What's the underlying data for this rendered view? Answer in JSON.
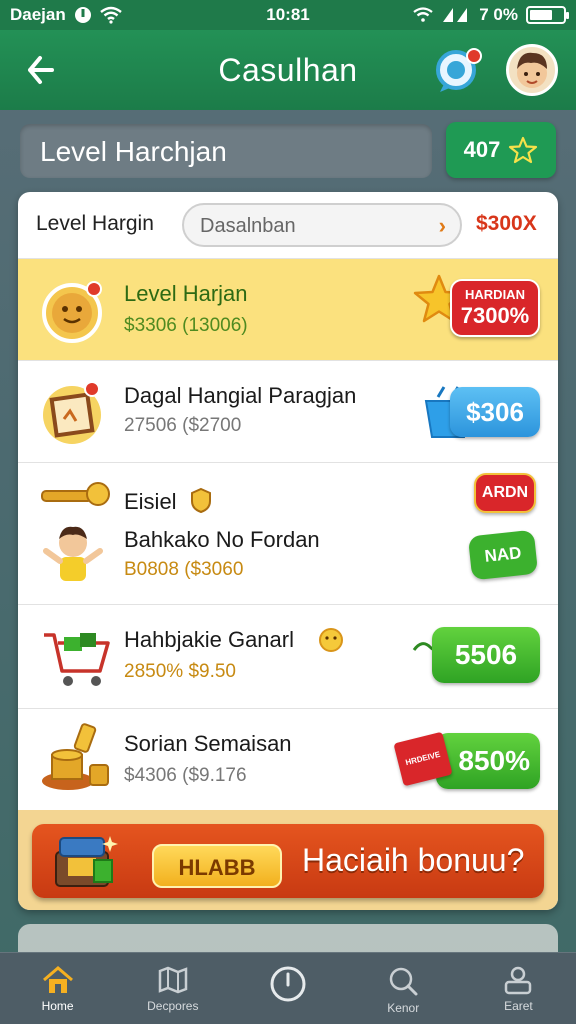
{
  "status_bar": {
    "carrier": "Daejan",
    "time": "10:81",
    "battery_text": "7 0%",
    "battery_level": 0.7
  },
  "app_bar": {
    "title": "Casulhan"
  },
  "header": {
    "level_label": "Level Harchjan",
    "coins": "407"
  },
  "card": {
    "head_label": "Level Hargin",
    "search_value": "Dasalnban",
    "head_price": "$300X",
    "rows": [
      {
        "title": "Level Harjan",
        "sub": "$3306 (13006)",
        "badge_top": "HARDIAN",
        "badge": "7300%"
      },
      {
        "title": "Dagal Hangial Paragjan",
        "sub": "27506 ($2700",
        "badge": "$306"
      },
      {
        "title_top": "Eisiel",
        "title": "Bahkako No Fordan",
        "sub": "B0808 ($3060",
        "badge_top": "ARDN",
        "badge": "NAD"
      },
      {
        "title": "Hahbjakie Ganarl",
        "sub": "2850% $9.50",
        "badge": "5506"
      },
      {
        "title": "Sorian Semaisan",
        "sub": "$4306 ($9.176",
        "badge_tag": "HRDEIVE",
        "badge": "850%"
      }
    ],
    "promo_tag": "HLABB",
    "promo_text": "Haciaih bonuu?"
  },
  "bottom_nav": [
    {
      "label": "Home",
      "icon": "home-icon"
    },
    {
      "label": "Decpores",
      "icon": "map-icon"
    },
    {
      "label": "",
      "icon": "clock-icon"
    },
    {
      "label": "Kenor",
      "icon": "search-icon"
    },
    {
      "label": "Earet",
      "icon": "profile-icon"
    }
  ],
  "colors": {
    "brand_green": "#1f7a4a",
    "accent_red": "#d8361a",
    "highlight_yellow": "#fbe17e",
    "badge_blue": "#2f9ee6",
    "badge_green": "#3cb12e"
  }
}
